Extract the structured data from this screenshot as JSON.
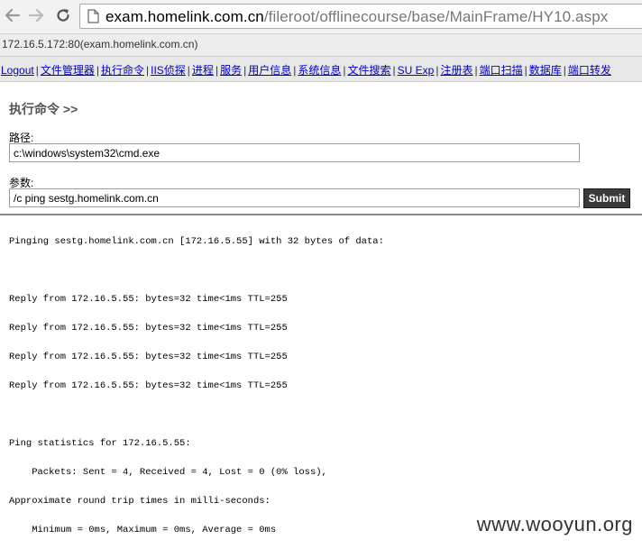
{
  "browser": {
    "url_host": "exam.homelink.com.cn",
    "url_path": "/fileroot/offlinecourse/base/MainFrame/HY10.aspx"
  },
  "server_info": "172.16.5.172:80(exam.homelink.com.cn)",
  "menu": {
    "items": [
      "Logout",
      "文件管理器",
      "执行命令",
      "IIS侦探",
      "进程",
      "服务",
      "用户信息",
      "系统信息",
      "文件搜索",
      "SU Exp",
      "注册表",
      "端口扫描",
      "数据库",
      "端口转发"
    ],
    "separator": "|"
  },
  "panel": {
    "title": "执行命令 >>",
    "path_label": "路径:",
    "path_value": "c:\\windows\\system32\\cmd.exe",
    "args_label": "参数:",
    "args_value": "/c ping sestg.homelink.com.cn",
    "submit_label": "Submit"
  },
  "output": {
    "lines": [
      "Pinging sestg.homelink.com.cn [172.16.5.55] with 32 bytes of data:",
      "Reply from 172.16.5.55: bytes=32 time<1ms TTL=255",
      "Reply from 172.16.5.55: bytes=32 time<1ms TTL=255",
      "Reply from 172.16.5.55: bytes=32 time<1ms TTL=255",
      "Reply from 172.16.5.55: bytes=32 time<1ms TTL=255",
      "Ping statistics for 172.16.5.55:",
      "    Packets: Sent = 4, Received = 4, Lost = 0 (0% loss),",
      "Approximate round trip times in milli-seconds:",
      "    Minimum = 0ms, Maximum = 0ms, Average = 0ms"
    ]
  },
  "watermark": "www.wooyun.org",
  "icons": {
    "back": "back-arrow-icon",
    "forward": "forward-arrow-icon",
    "reload": "reload-icon",
    "page": "page-icon"
  }
}
